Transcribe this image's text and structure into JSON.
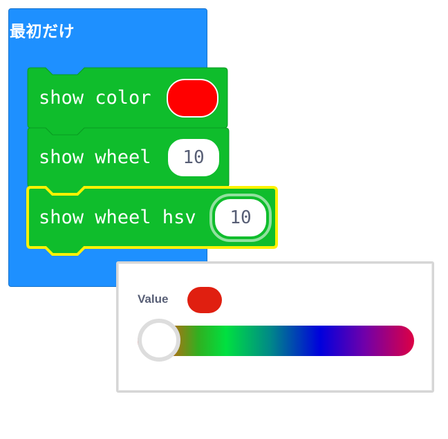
{
  "event_block": {
    "title": "最初だけ",
    "color": "#1E90FF"
  },
  "blocks": [
    {
      "label": "show color",
      "field_type": "color",
      "value_color": "#FF0000"
    },
    {
      "label": "show wheel",
      "field_type": "number",
      "value": "10"
    },
    {
      "label": "show wheel hsv",
      "field_type": "number",
      "value": "10",
      "selected": true
    }
  ],
  "block_color": "#0FBD2C",
  "selection_color": "#FFF200",
  "color_picker": {
    "label": "Value",
    "selected_color": "#E01F10",
    "slider_value": 0
  }
}
